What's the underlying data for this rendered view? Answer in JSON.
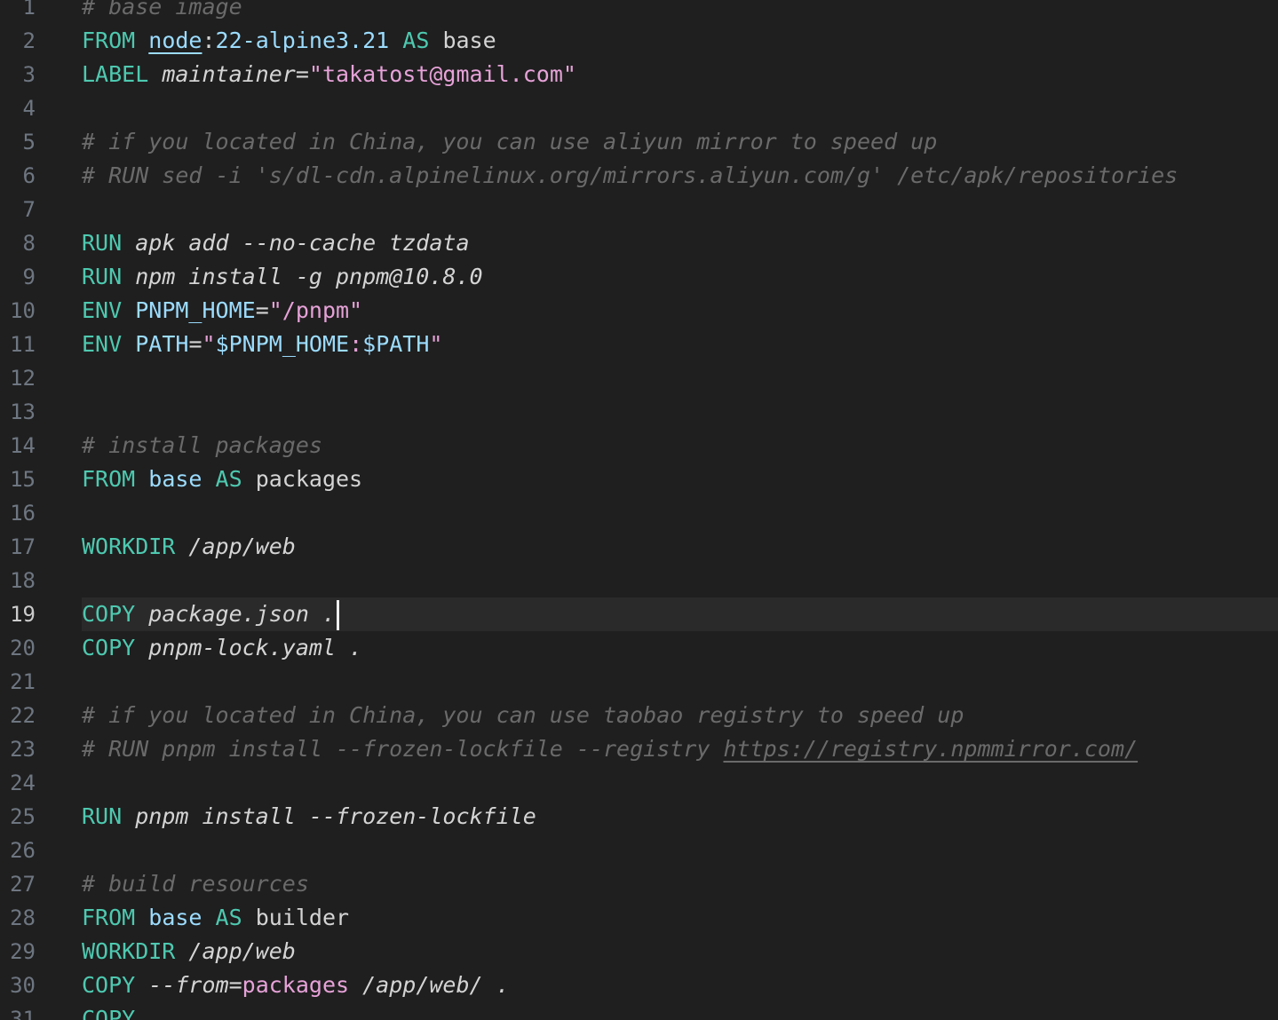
{
  "editor": {
    "current_line": 19,
    "lines": [
      {
        "n": "1",
        "tokens": [
          {
            "t": "# base image",
            "c": "cm"
          }
        ]
      },
      {
        "n": "2",
        "tokens": [
          {
            "t": "FROM ",
            "c": "kw"
          },
          {
            "t": "node",
            "c": "img"
          },
          {
            "t": ":",
            "c": "pl"
          },
          {
            "t": "22-alpine3.21",
            "c": "tag"
          },
          {
            "t": " AS ",
            "c": "kw"
          },
          {
            "t": "base",
            "c": "pl"
          }
        ]
      },
      {
        "n": "3",
        "tokens": [
          {
            "t": "LABEL ",
            "c": "kw"
          },
          {
            "t": "maintainer",
            "c": "it"
          },
          {
            "t": "=",
            "c": "pl"
          },
          {
            "t": "\"takatost@gmail.com\"",
            "c": "str2"
          }
        ]
      },
      {
        "n": "4",
        "tokens": []
      },
      {
        "n": "5",
        "tokens": [
          {
            "t": "# if you located in China, you can use aliyun mirror to speed up",
            "c": "cm"
          }
        ]
      },
      {
        "n": "6",
        "tokens": [
          {
            "t": "# RUN sed -i 's/dl-cdn.alpinelinux.org/mirrors.aliyun.com/g' /etc/apk/repositories",
            "c": "cm"
          }
        ]
      },
      {
        "n": "7",
        "tokens": []
      },
      {
        "n": "8",
        "tokens": [
          {
            "t": "RUN ",
            "c": "kw"
          },
          {
            "t": "apk add --no-cache tzdata",
            "c": "it"
          }
        ]
      },
      {
        "n": "9",
        "tokens": [
          {
            "t": "RUN ",
            "c": "kw"
          },
          {
            "t": "npm install -g pnpm@10.8.0",
            "c": "it"
          }
        ]
      },
      {
        "n": "10",
        "tokens": [
          {
            "t": "ENV ",
            "c": "kw"
          },
          {
            "t": "PNPM_HOME",
            "c": "var"
          },
          {
            "t": "=",
            "c": "pl"
          },
          {
            "t": "\"/pnpm\"",
            "c": "str2"
          }
        ]
      },
      {
        "n": "11",
        "tokens": [
          {
            "t": "ENV ",
            "c": "kw"
          },
          {
            "t": "PATH",
            "c": "var"
          },
          {
            "t": "=",
            "c": "pl"
          },
          {
            "t": "\"",
            "c": "str2"
          },
          {
            "t": "$PNPM_HOME",
            "c": "var"
          },
          {
            "t": ":",
            "c": "str2"
          },
          {
            "t": "$PATH",
            "c": "var"
          },
          {
            "t": "\"",
            "c": "str2"
          }
        ]
      },
      {
        "n": "12",
        "tokens": []
      },
      {
        "n": "13",
        "tokens": []
      },
      {
        "n": "14",
        "tokens": [
          {
            "t": "# install packages",
            "c": "cm"
          }
        ]
      },
      {
        "n": "15",
        "tokens": [
          {
            "t": "FROM ",
            "c": "kw"
          },
          {
            "t": "base",
            "c": "var"
          },
          {
            "t": " AS ",
            "c": "kw"
          },
          {
            "t": "packages",
            "c": "pl"
          }
        ]
      },
      {
        "n": "16",
        "tokens": []
      },
      {
        "n": "17",
        "tokens": [
          {
            "t": "WORKDIR ",
            "c": "kw"
          },
          {
            "t": "/app/web",
            "c": "it"
          }
        ]
      },
      {
        "n": "18",
        "tokens": []
      },
      {
        "n": "19",
        "tokens": [
          {
            "t": "COPY ",
            "c": "kw"
          },
          {
            "t": "package.json .",
            "c": "it"
          }
        ]
      },
      {
        "n": "20",
        "tokens": [
          {
            "t": "COPY ",
            "c": "kw"
          },
          {
            "t": "pnpm-lock.yaml .",
            "c": "it"
          }
        ]
      },
      {
        "n": "21",
        "tokens": []
      },
      {
        "n": "22",
        "tokens": [
          {
            "t": "# if you located in China, you can use taobao registry to speed up",
            "c": "cm"
          }
        ]
      },
      {
        "n": "23",
        "tokens": [
          {
            "t": "# RUN pnpm install --frozen-lockfile --registry ",
            "c": "cm"
          },
          {
            "t": "https://registry.npmmirror.com/",
            "c": "cm link"
          }
        ]
      },
      {
        "n": "24",
        "tokens": []
      },
      {
        "n": "25",
        "tokens": [
          {
            "t": "RUN ",
            "c": "kw"
          },
          {
            "t": "pnpm install --frozen-lockfile",
            "c": "it"
          }
        ]
      },
      {
        "n": "26",
        "tokens": []
      },
      {
        "n": "27",
        "tokens": [
          {
            "t": "# build resources",
            "c": "cm"
          }
        ]
      },
      {
        "n": "28",
        "tokens": [
          {
            "t": "FROM ",
            "c": "kw"
          },
          {
            "t": "base",
            "c": "var"
          },
          {
            "t": " AS ",
            "c": "kw"
          },
          {
            "t": "builder",
            "c": "pl"
          }
        ]
      },
      {
        "n": "29",
        "tokens": [
          {
            "t": "WORKDIR ",
            "c": "kw"
          },
          {
            "t": "/app/web",
            "c": "it"
          }
        ]
      },
      {
        "n": "30",
        "tokens": [
          {
            "t": "COPY ",
            "c": "kw"
          },
          {
            "t": "--from",
            "c": "it"
          },
          {
            "t": "=",
            "c": "pl"
          },
          {
            "t": "packages",
            "c": "str2"
          },
          {
            "t": " /app/web/ .",
            "c": "it"
          }
        ]
      },
      {
        "n": "31",
        "tokens": [
          {
            "t": "COPY",
            "c": "kw"
          }
        ]
      }
    ]
  }
}
